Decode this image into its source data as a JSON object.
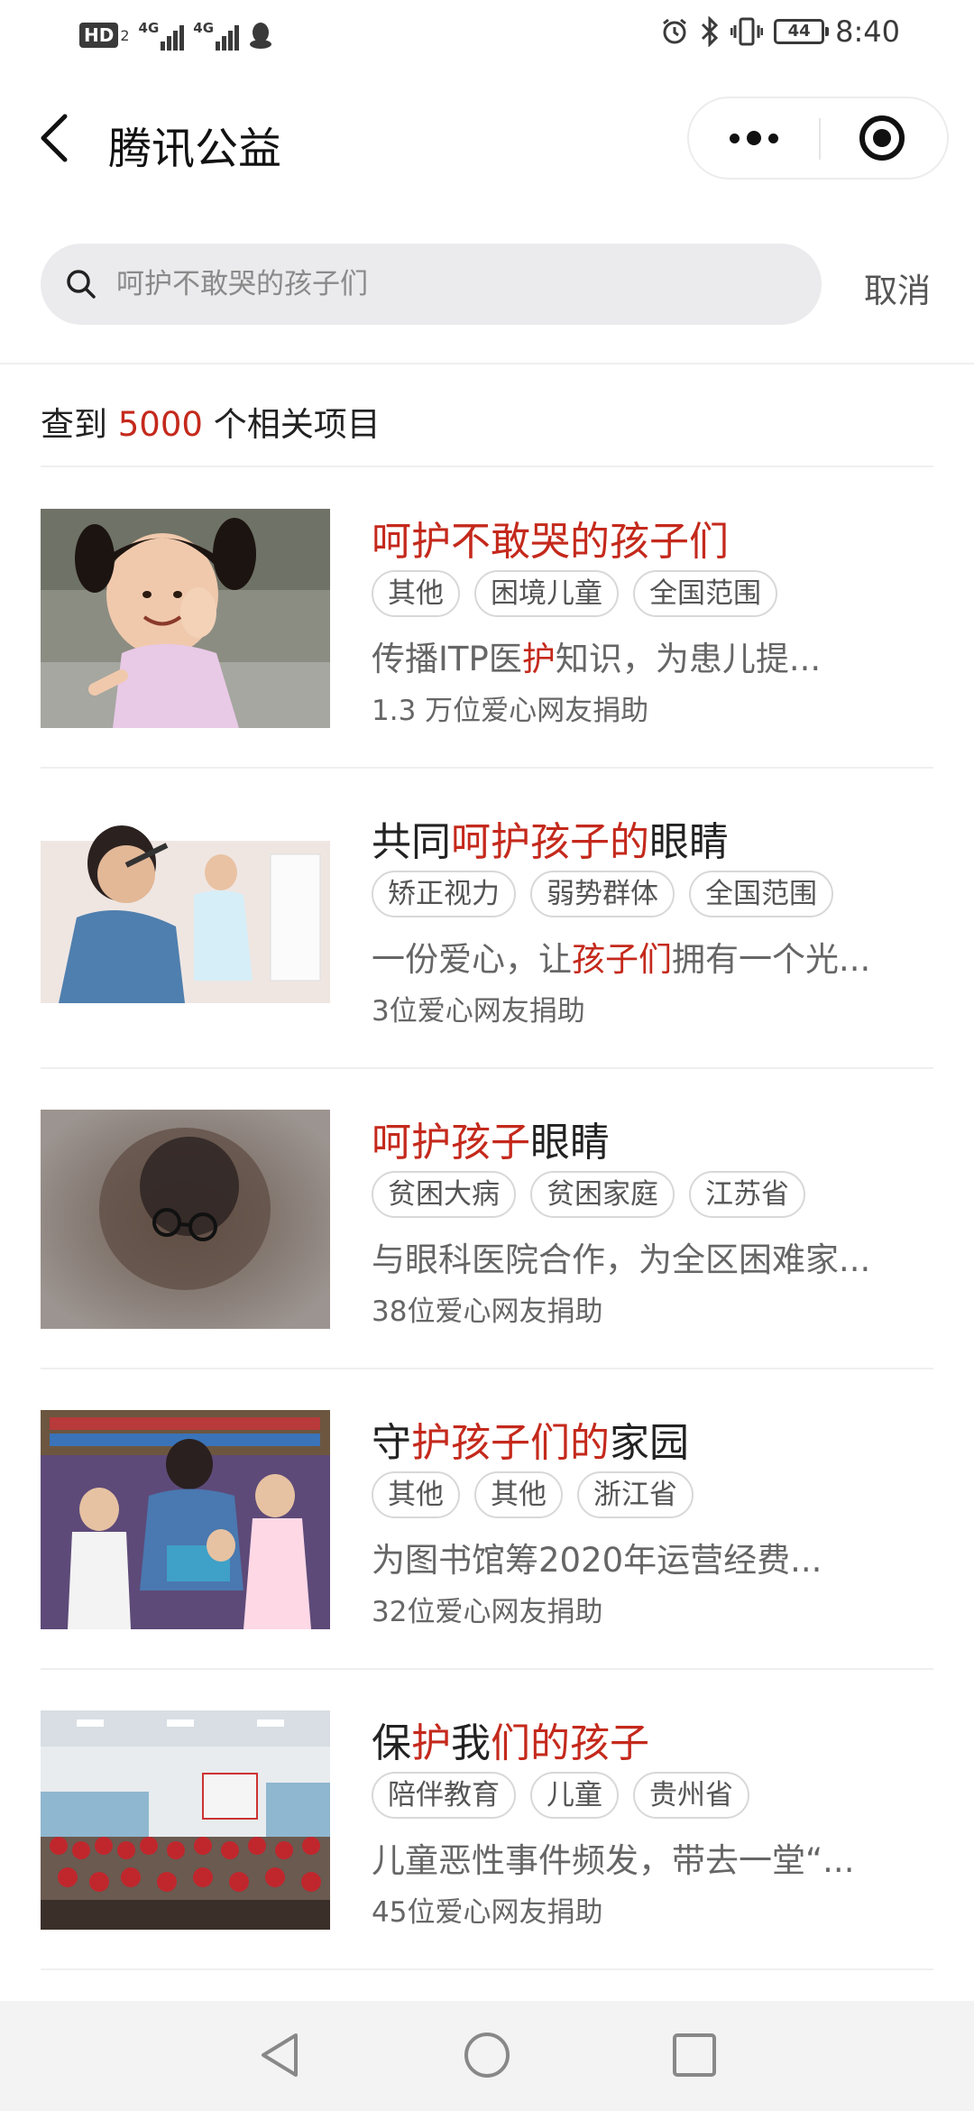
{
  "status_bar": {
    "hd_label": "HD",
    "hd_sub": "2",
    "net1": "4G",
    "net2": "4G",
    "battery": "44",
    "time": "8:40"
  },
  "nav": {
    "title": "腾讯公益"
  },
  "search": {
    "placeholder": "呵护不敢哭的孩子们",
    "cancel_label": "取消"
  },
  "results": {
    "prefix": "查到 ",
    "count": "5000",
    "suffix": " 个相关项目"
  },
  "items": [
    {
      "title_parts": [
        {
          "text": "呵护不敢哭的孩子们",
          "hl": true
        }
      ],
      "tags": [
        "其他",
        "困境儿童",
        "全国范围"
      ],
      "desc_parts": [
        {
          "text": "传播ITP医",
          "hl": false
        },
        {
          "text": "护",
          "hl": true
        },
        {
          "text": "知识，为患儿提...",
          "hl": false
        }
      ],
      "donors": "1.3 万位爱心网友捐助"
    },
    {
      "title_parts": [
        {
          "text": "共同",
          "hl": false
        },
        {
          "text": "呵护孩子的",
          "hl": true
        },
        {
          "text": "眼睛",
          "hl": false
        }
      ],
      "tags": [
        "矫正视力",
        "弱势群体",
        "全国范围"
      ],
      "desc_parts": [
        {
          "text": "一份爱心，让",
          "hl": false
        },
        {
          "text": "孩子们",
          "hl": true
        },
        {
          "text": "拥有一个光...",
          "hl": false
        }
      ],
      "donors": "3位爱心网友捐助"
    },
    {
      "title_parts": [
        {
          "text": "呵护孩子",
          "hl": true
        },
        {
          "text": "眼睛",
          "hl": false
        }
      ],
      "tags": [
        "贫困大病",
        "贫困家庭",
        "江苏省"
      ],
      "desc_parts": [
        {
          "text": "与眼科医院合作，为全区困难家...",
          "hl": false
        }
      ],
      "donors": "38位爱心网友捐助"
    },
    {
      "title_parts": [
        {
          "text": "守",
          "hl": false
        },
        {
          "text": "护孩子们的",
          "hl": true
        },
        {
          "text": "家园",
          "hl": false
        }
      ],
      "tags": [
        "其他",
        "其他",
        "浙江省"
      ],
      "desc_parts": [
        {
          "text": "为图书馆筹2020年运营经费...",
          "hl": false
        }
      ],
      "donors": "32位爱心网友捐助"
    },
    {
      "title_parts": [
        {
          "text": "保",
          "hl": false
        },
        {
          "text": "护",
          "hl": true
        },
        {
          "text": "我",
          "hl": false
        },
        {
          "text": "们的孩子",
          "hl": true
        }
      ],
      "tags": [
        "陪伴教育",
        "儿童",
        "贵州省"
      ],
      "desc_parts": [
        {
          "text": "儿童恶性事件频发，带去一堂“...",
          "hl": false
        }
      ],
      "donors": "45位爱心网友捐助"
    }
  ],
  "colors": {
    "highlight": "#c4291c",
    "tag_border": "#d8d8d8",
    "search_bg": "#ebebed"
  }
}
